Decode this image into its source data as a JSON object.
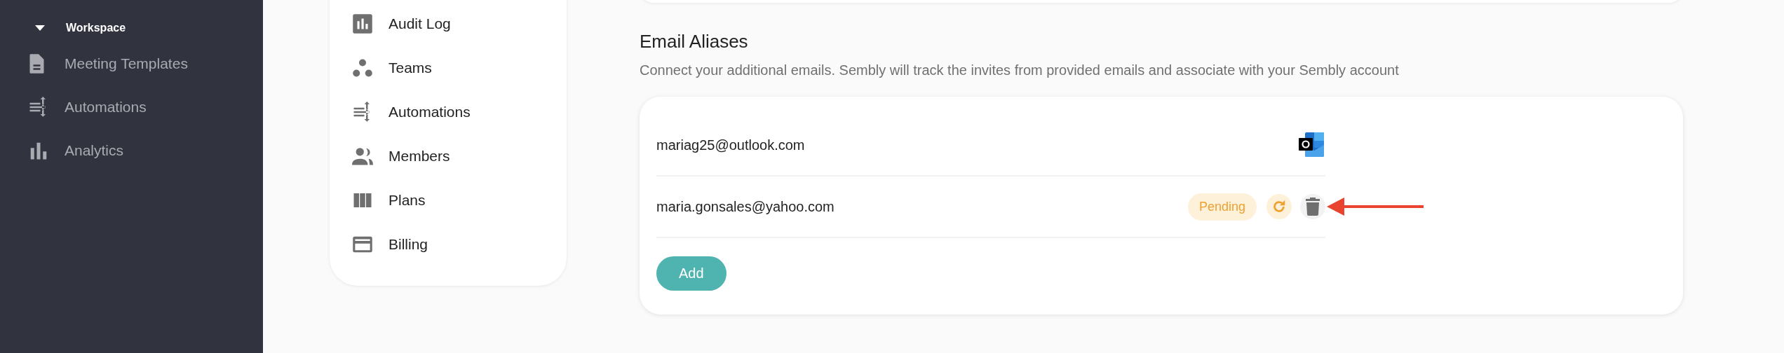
{
  "sidebar": {
    "section": {
      "label": "Workspace",
      "expanded": true
    },
    "items": [
      {
        "label": "Meeting Templates",
        "kind": "document"
      },
      {
        "label": "Automations",
        "kind": "flows"
      },
      {
        "label": "Analytics",
        "kind": "bars"
      }
    ]
  },
  "settings_menu": {
    "items": [
      {
        "label": "Audit Log",
        "kind": "chart"
      },
      {
        "label": "Teams",
        "kind": "dots"
      },
      {
        "label": "Automations",
        "kind": "flows"
      },
      {
        "label": "Members",
        "kind": "people"
      },
      {
        "label": "Plans",
        "kind": "columns"
      },
      {
        "label": "Billing",
        "kind": "card"
      }
    ]
  },
  "email_aliases": {
    "title": "Email Aliases",
    "description": "Connect your additional emails. Sembly will track the invites from provided emails and associate with your Sembly account",
    "aliases": [
      {
        "email": "mariag25@outlook.com",
        "kind": "connected"
      },
      {
        "email": "maria.gonsales@yahoo.com",
        "kind": "pending",
        "badge": "Pending",
        "annotated": true
      }
    ],
    "add_button": "Add"
  }
}
